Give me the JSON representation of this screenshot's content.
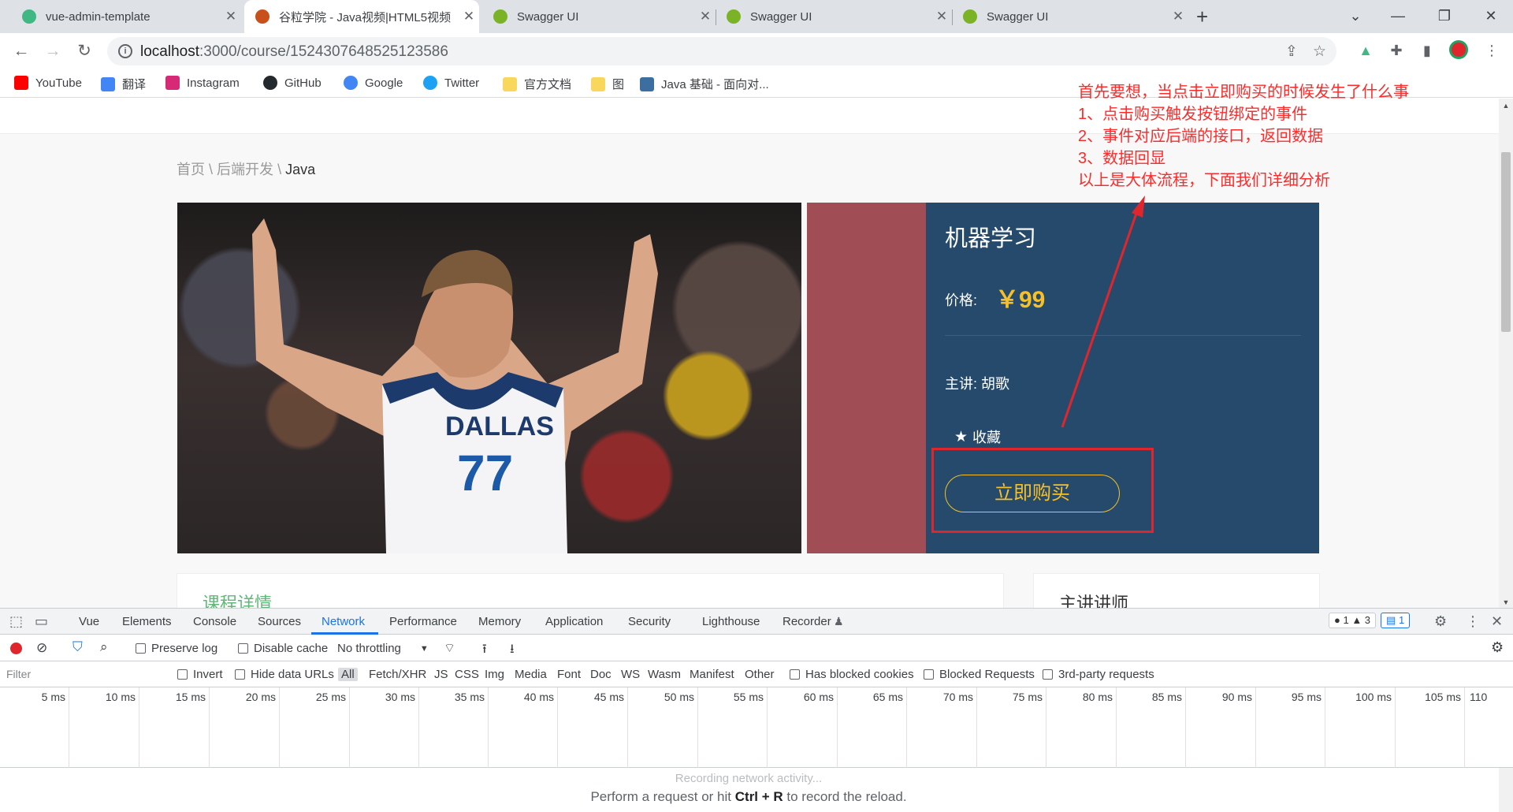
{
  "browser": {
    "tabs": [
      {
        "title": "vue-admin-template",
        "favicon_color": "#41b883"
      },
      {
        "title": "谷粒学院 - Java视频|HTML5视频",
        "favicon_color": "#c8501b"
      },
      {
        "title": "Swagger UI",
        "favicon_color": "#7ab326"
      },
      {
        "title": "Swagger UI",
        "favicon_color": "#7ab326"
      },
      {
        "title": "Swagger UI",
        "favicon_color": "#7ab326"
      }
    ],
    "url_host": "localhost",
    "url_path": ":3000/course/1524307648525123586",
    "bookmarks": [
      {
        "label": "YouTube",
        "icon": "youtube-icon",
        "color": "#ff0000"
      },
      {
        "label": "翻译",
        "icon": "translate-icon",
        "color": "#4285f4"
      },
      {
        "label": "Instagram",
        "icon": "instagram-icon",
        "color": "#d62976"
      },
      {
        "label": "GitHub",
        "icon": "github-icon",
        "color": "#24292e"
      },
      {
        "label": "Google",
        "icon": "google-icon",
        "color": "#4285f4"
      },
      {
        "label": "Twitter",
        "icon": "twitter-icon",
        "color": "#1da1f2"
      },
      {
        "label": "官方文档",
        "icon": "folder-icon",
        "color": "#f9d65c"
      },
      {
        "label": "图",
        "icon": "folder-icon",
        "color": "#f9d65c"
      },
      {
        "label": "Java 基础 - 面向对...",
        "icon": "page-icon",
        "color": "#3c6e9f"
      }
    ]
  },
  "page": {
    "breadcrumb": {
      "home": "首页",
      "sep": "\\",
      "category": "后端开发",
      "current": "Java"
    },
    "course": {
      "title": "机器学习",
      "price_label": "价格:",
      "price": "￥99",
      "teacher_label": "主讲:",
      "teacher": "胡歌",
      "collect_label": "收藏",
      "buy_label": "立即购买"
    },
    "cards": {
      "detail_title": "课程详情",
      "teacher_title": "主讲讲师"
    },
    "annotation": {
      "lines": [
        "首先要想，当点击立即购买的时候发生了什么事",
        "1、点击购买触发按钮绑定的事件",
        "2、事件对应后端的接口，返回数据",
        "3、数据回显",
        "以上是大体流程，下面我们详细分析"
      ]
    }
  },
  "devtools": {
    "tabs": [
      "Vue",
      "Elements",
      "Console",
      "Sources",
      "Network",
      "Performance",
      "Memory",
      "Application",
      "Security",
      "Lighthouse",
      "Recorder"
    ],
    "active_tab": "Network",
    "badges": {
      "errors": "1",
      "warnings": "3",
      "messages": "1"
    },
    "toolbar": {
      "preserve_log": "Preserve log",
      "disable_cache": "Disable cache",
      "throttling": "No throttling"
    },
    "filter_placeholder": "Filter",
    "filters": [
      "Invert",
      "Hide data URLs",
      "All",
      "Fetch/XHR",
      "JS",
      "CSS",
      "Img",
      "Media",
      "Font",
      "Doc",
      "WS",
      "Wasm",
      "Manifest",
      "Other",
      "Has blocked cookies",
      "Blocked Requests",
      "3rd-party requests"
    ],
    "timeline_ticks": [
      "5 ms",
      "10 ms",
      "15 ms",
      "20 ms",
      "25 ms",
      "30 ms",
      "35 ms",
      "40 ms",
      "45 ms",
      "50 ms",
      "55 ms",
      "60 ms",
      "65 ms",
      "70 ms",
      "75 ms",
      "80 ms",
      "85 ms",
      "90 ms",
      "95 ms",
      "100 ms",
      "105 ms",
      "110"
    ],
    "empty_line1": "Recording network activity...",
    "empty_prefix": "Perform a request or hit ",
    "empty_keys": "Ctrl + R",
    "empty_suffix": " to record the reload."
  }
}
